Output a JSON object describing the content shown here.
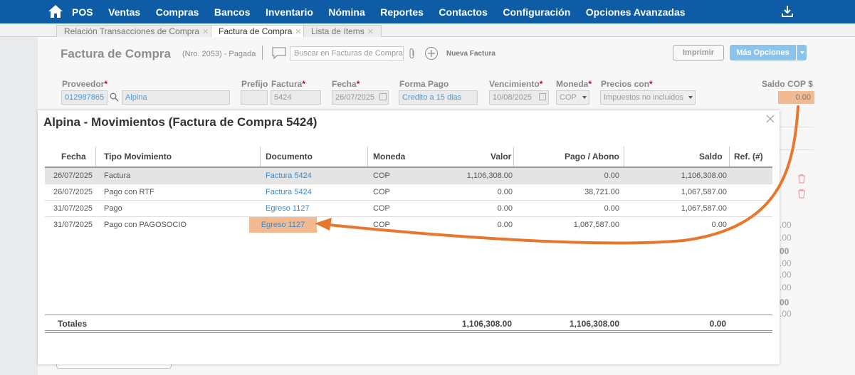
{
  "nav": {
    "items": [
      "POS",
      "Ventas",
      "Compras",
      "Bancos",
      "Inventario",
      "Nómina",
      "Reportes",
      "Contactos",
      "Configuración",
      "Opciones Avanzadas"
    ]
  },
  "tabs": [
    {
      "label": "Relación Transacciones de Compra",
      "active": false
    },
    {
      "label": "Factura de Compra",
      "active": true
    },
    {
      "label": "Lista de ítems",
      "active": false
    }
  ],
  "header": {
    "title": "Factura de Compra",
    "subtitle": "(Nro. 2053) - Pagada",
    "search_placeholder": "Buscar en Facturas de Compra",
    "new_label": "Nueva Factura",
    "print_label": "Imprimir",
    "more_label": "Más Opciones"
  },
  "form": {
    "labels": {
      "proveedor": "Proveedor",
      "prefijo": "Prefijo",
      "factura": "Factura",
      "fecha": "Fecha",
      "forma_pago": "Forma Pago",
      "vencimiento": "Vencimiento",
      "moneda": "Moneda",
      "precios": "Precios con",
      "saldo": "Saldo COP $"
    },
    "values": {
      "proveedor_id": "012987865",
      "proveedor_nombre": "Alpina",
      "prefijo": "",
      "factura": "5424",
      "fecha": "26/07/2025",
      "forma_pago": "Credito a 15 dias",
      "vencimiento": "10/08/2025",
      "moneda": "COP",
      "precios": "Impuestos no incluidos",
      "saldo": "0.00"
    },
    "peek_values": [
      ".00",
      ".00",
      "00",
      ".00",
      ".00",
      ".00",
      "00",
      ".00"
    ]
  },
  "modal": {
    "title": "Alpina - Movimientos (Factura de Compra 5424)",
    "columns": [
      "Fecha",
      "Tipo Movimiento",
      "Documento",
      "Moneda",
      "Valor",
      "Pago / Abono",
      "Saldo",
      "Ref. (#)"
    ],
    "rows": [
      {
        "fecha": "26/07/2025",
        "tipo": "Factura",
        "documento": "Factura 5424",
        "moneda": "COP",
        "valor": "1,106,308.00",
        "pago": "0.00",
        "saldo": "1,106,308.00",
        "ref": ""
      },
      {
        "fecha": "26/07/2025",
        "tipo": "Pago con RTF",
        "documento": "Factura 5424",
        "moneda": "COP",
        "valor": "0.00",
        "pago": "38,721.00",
        "saldo": "1,067,587.00",
        "ref": ""
      },
      {
        "fecha": "31/07/2025",
        "tipo": "Pago",
        "documento": "Egreso 1127",
        "moneda": "COP",
        "valor": "0.00",
        "pago": "0.00",
        "saldo": "1,067,587.00",
        "ref": ""
      },
      {
        "fecha": "31/07/2025",
        "tipo": "Pago con PAGOSOCIO",
        "documento": "Egreso 1127",
        "moneda": "COP",
        "valor": "0.00",
        "pago": "1,067,587.00",
        "saldo": "0.00",
        "ref": ""
      }
    ],
    "totals": {
      "label": "Totales",
      "valor": "1,106,308.00",
      "pago": "1,106,308.00",
      "saldo": "0.00"
    }
  },
  "colors": {
    "nav": "#0e5ba6",
    "highlight": "#f2ba91",
    "arrow": "#e8772e",
    "link": "#3a87c8"
  }
}
